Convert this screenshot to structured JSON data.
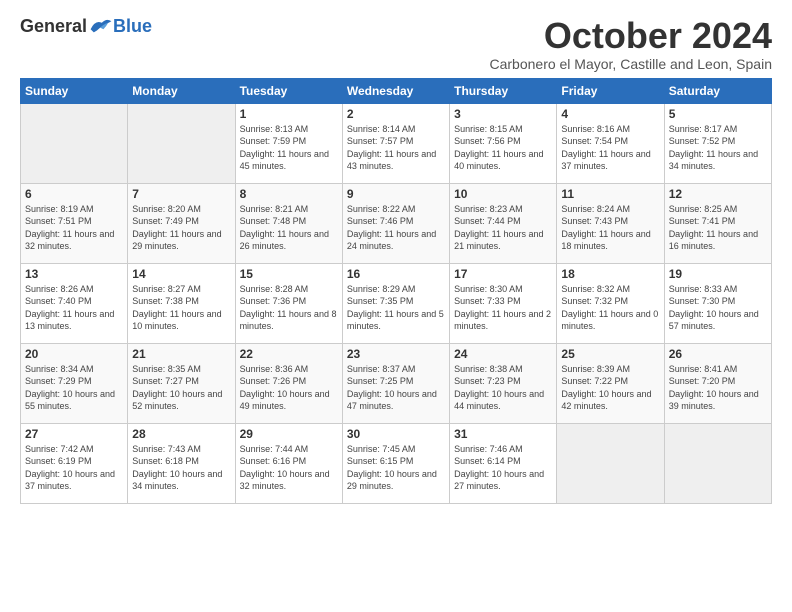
{
  "header": {
    "logo_general": "General",
    "logo_blue": "Blue",
    "month_title": "October 2024",
    "subtitle": "Carbonero el Mayor, Castille and Leon, Spain"
  },
  "days_of_week": [
    "Sunday",
    "Monday",
    "Tuesday",
    "Wednesday",
    "Thursday",
    "Friday",
    "Saturday"
  ],
  "weeks": [
    {
      "days": [
        {
          "num": "",
          "info": "",
          "empty": true
        },
        {
          "num": "",
          "info": "",
          "empty": true
        },
        {
          "num": "1",
          "info": "Sunrise: 8:13 AM\nSunset: 7:59 PM\nDaylight: 11 hours and 45 minutes.",
          "empty": false
        },
        {
          "num": "2",
          "info": "Sunrise: 8:14 AM\nSunset: 7:57 PM\nDaylight: 11 hours and 43 minutes.",
          "empty": false
        },
        {
          "num": "3",
          "info": "Sunrise: 8:15 AM\nSunset: 7:56 PM\nDaylight: 11 hours and 40 minutes.",
          "empty": false
        },
        {
          "num": "4",
          "info": "Sunrise: 8:16 AM\nSunset: 7:54 PM\nDaylight: 11 hours and 37 minutes.",
          "empty": false
        },
        {
          "num": "5",
          "info": "Sunrise: 8:17 AM\nSunset: 7:52 PM\nDaylight: 11 hours and 34 minutes.",
          "empty": false
        }
      ]
    },
    {
      "days": [
        {
          "num": "6",
          "info": "Sunrise: 8:19 AM\nSunset: 7:51 PM\nDaylight: 11 hours and 32 minutes.",
          "empty": false
        },
        {
          "num": "7",
          "info": "Sunrise: 8:20 AM\nSunset: 7:49 PM\nDaylight: 11 hours and 29 minutes.",
          "empty": false
        },
        {
          "num": "8",
          "info": "Sunrise: 8:21 AM\nSunset: 7:48 PM\nDaylight: 11 hours and 26 minutes.",
          "empty": false
        },
        {
          "num": "9",
          "info": "Sunrise: 8:22 AM\nSunset: 7:46 PM\nDaylight: 11 hours and 24 minutes.",
          "empty": false
        },
        {
          "num": "10",
          "info": "Sunrise: 8:23 AM\nSunset: 7:44 PM\nDaylight: 11 hours and 21 minutes.",
          "empty": false
        },
        {
          "num": "11",
          "info": "Sunrise: 8:24 AM\nSunset: 7:43 PM\nDaylight: 11 hours and 18 minutes.",
          "empty": false
        },
        {
          "num": "12",
          "info": "Sunrise: 8:25 AM\nSunset: 7:41 PM\nDaylight: 11 hours and 16 minutes.",
          "empty": false
        }
      ]
    },
    {
      "days": [
        {
          "num": "13",
          "info": "Sunrise: 8:26 AM\nSunset: 7:40 PM\nDaylight: 11 hours and 13 minutes.",
          "empty": false
        },
        {
          "num": "14",
          "info": "Sunrise: 8:27 AM\nSunset: 7:38 PM\nDaylight: 11 hours and 10 minutes.",
          "empty": false
        },
        {
          "num": "15",
          "info": "Sunrise: 8:28 AM\nSunset: 7:36 PM\nDaylight: 11 hours and 8 minutes.",
          "empty": false
        },
        {
          "num": "16",
          "info": "Sunrise: 8:29 AM\nSunset: 7:35 PM\nDaylight: 11 hours and 5 minutes.",
          "empty": false
        },
        {
          "num": "17",
          "info": "Sunrise: 8:30 AM\nSunset: 7:33 PM\nDaylight: 11 hours and 2 minutes.",
          "empty": false
        },
        {
          "num": "18",
          "info": "Sunrise: 8:32 AM\nSunset: 7:32 PM\nDaylight: 11 hours and 0 minutes.",
          "empty": false
        },
        {
          "num": "19",
          "info": "Sunrise: 8:33 AM\nSunset: 7:30 PM\nDaylight: 10 hours and 57 minutes.",
          "empty": false
        }
      ]
    },
    {
      "days": [
        {
          "num": "20",
          "info": "Sunrise: 8:34 AM\nSunset: 7:29 PM\nDaylight: 10 hours and 55 minutes.",
          "empty": false
        },
        {
          "num": "21",
          "info": "Sunrise: 8:35 AM\nSunset: 7:27 PM\nDaylight: 10 hours and 52 minutes.",
          "empty": false
        },
        {
          "num": "22",
          "info": "Sunrise: 8:36 AM\nSunset: 7:26 PM\nDaylight: 10 hours and 49 minutes.",
          "empty": false
        },
        {
          "num": "23",
          "info": "Sunrise: 8:37 AM\nSunset: 7:25 PM\nDaylight: 10 hours and 47 minutes.",
          "empty": false
        },
        {
          "num": "24",
          "info": "Sunrise: 8:38 AM\nSunset: 7:23 PM\nDaylight: 10 hours and 44 minutes.",
          "empty": false
        },
        {
          "num": "25",
          "info": "Sunrise: 8:39 AM\nSunset: 7:22 PM\nDaylight: 10 hours and 42 minutes.",
          "empty": false
        },
        {
          "num": "26",
          "info": "Sunrise: 8:41 AM\nSunset: 7:20 PM\nDaylight: 10 hours and 39 minutes.",
          "empty": false
        }
      ]
    },
    {
      "days": [
        {
          "num": "27",
          "info": "Sunrise: 7:42 AM\nSunset: 6:19 PM\nDaylight: 10 hours and 37 minutes.",
          "empty": false
        },
        {
          "num": "28",
          "info": "Sunrise: 7:43 AM\nSunset: 6:18 PM\nDaylight: 10 hours and 34 minutes.",
          "empty": false
        },
        {
          "num": "29",
          "info": "Sunrise: 7:44 AM\nSunset: 6:16 PM\nDaylight: 10 hours and 32 minutes.",
          "empty": false
        },
        {
          "num": "30",
          "info": "Sunrise: 7:45 AM\nSunset: 6:15 PM\nDaylight: 10 hours and 29 minutes.",
          "empty": false
        },
        {
          "num": "31",
          "info": "Sunrise: 7:46 AM\nSunset: 6:14 PM\nDaylight: 10 hours and 27 minutes.",
          "empty": false
        },
        {
          "num": "",
          "info": "",
          "empty": true
        },
        {
          "num": "",
          "info": "",
          "empty": true
        }
      ]
    }
  ]
}
